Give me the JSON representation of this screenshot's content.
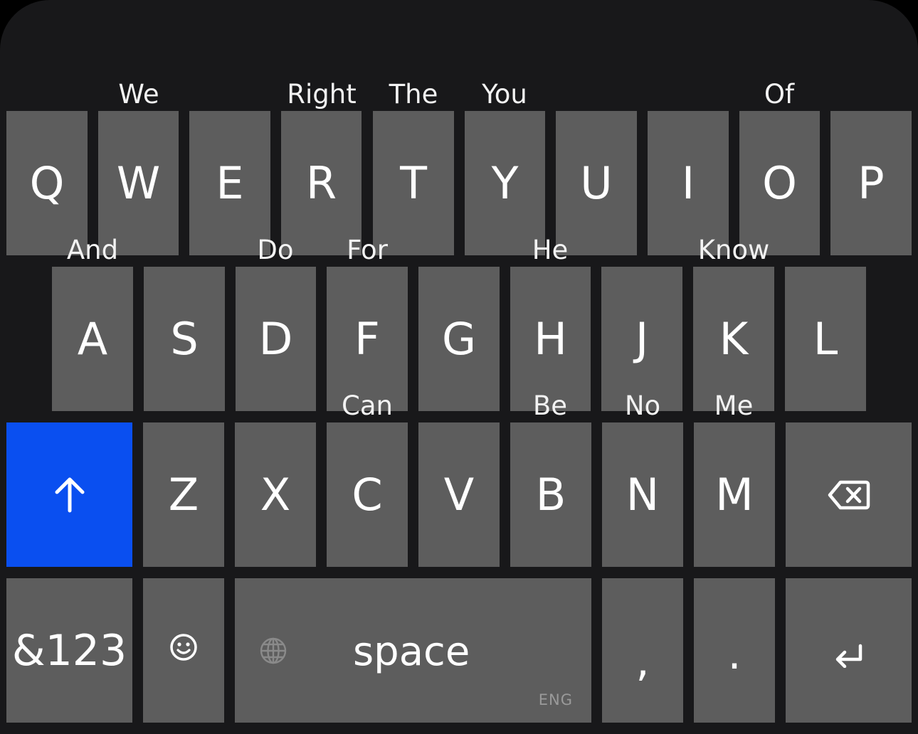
{
  "keyboard": {
    "colors": {
      "background": "#18181a",
      "key": "#5d5d5d",
      "shift_active": "#0a4ff0",
      "text": "#ffffff"
    },
    "rows": {
      "row1": [
        "Q",
        "W",
        "E",
        "R",
        "T",
        "Y",
        "U",
        "I",
        "O",
        "P"
      ],
      "row2": [
        "A",
        "S",
        "D",
        "F",
        "G",
        "H",
        "J",
        "K",
        "L"
      ],
      "row3": [
        "Z",
        "X",
        "C",
        "V",
        "B",
        "N",
        "M"
      ]
    },
    "hints": {
      "row1": [
        "We",
        "Right",
        "The",
        "You",
        "Of"
      ],
      "row2": [
        "And",
        "Do",
        "For",
        "He",
        "Know"
      ],
      "row3": [
        "Can",
        "Be",
        "No",
        "Me"
      ]
    },
    "keys": {
      "shift_icon": "arrow-up-icon",
      "delete_icon": "backspace-icon",
      "numbers_label": "&123",
      "emoji_icon": "smiley-icon",
      "globe_icon": "globe-icon",
      "space_label": "space",
      "language_label": "ENG",
      "comma_label": ",",
      "period_label": ".",
      "return_icon": "return-arrow-icon"
    }
  }
}
